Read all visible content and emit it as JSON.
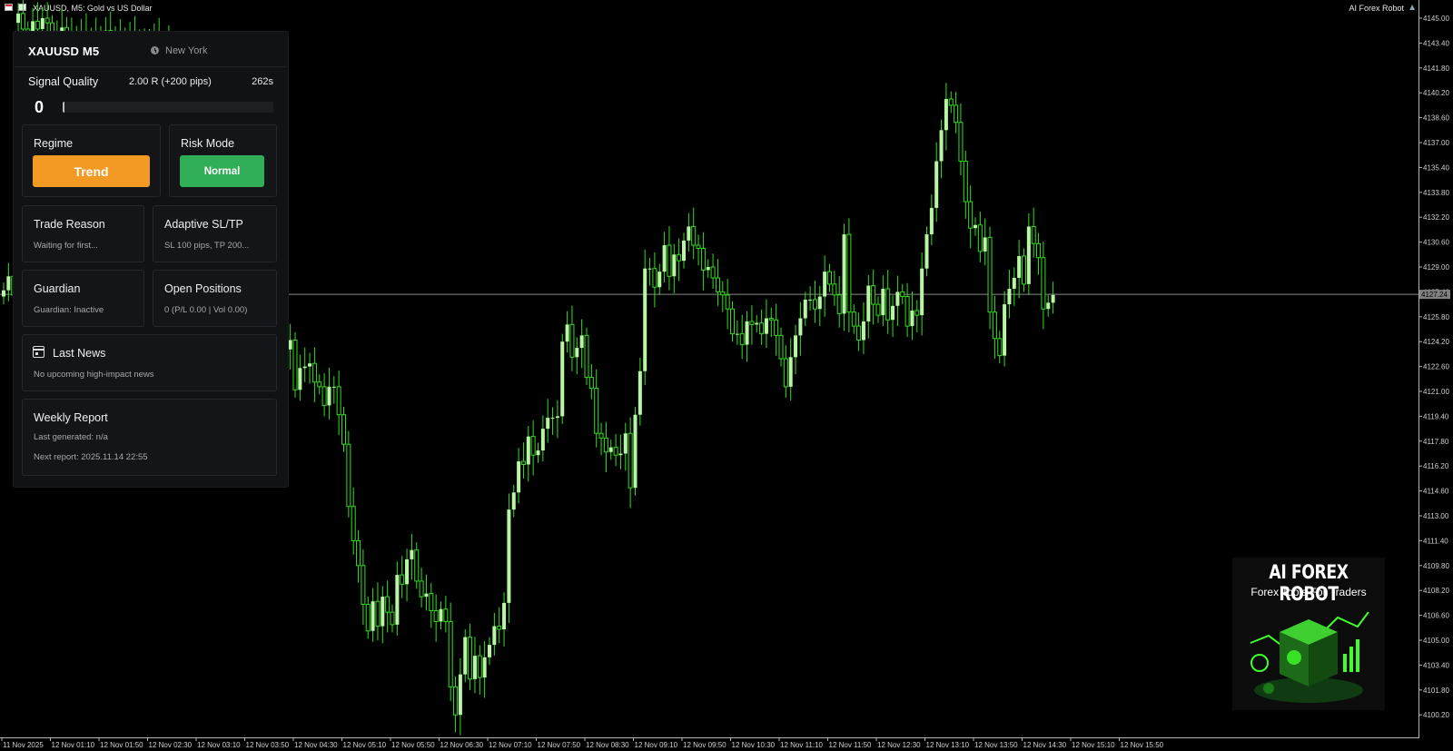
{
  "window": {
    "title": "XAUUSD, M5:  Gold vs US Dollar",
    "robot": "AI Forex Robot"
  },
  "panel": {
    "symbol": "XAUUSD M5",
    "city": "New York",
    "signal_quality": {
      "label": "Signal Quality",
      "value": "2.00 R (+200 pips)",
      "timer": "262s",
      "score": "0",
      "score_fraction": 0
    },
    "regime": {
      "title": "Regime",
      "value": "Trend",
      "color": "#f39a24"
    },
    "risk_mode": {
      "title": "Risk Mode",
      "value": "Normal",
      "color": "#2fae57"
    },
    "trade_reason": {
      "title": "Trade Reason",
      "text": "Waiting for first..."
    },
    "adaptive": {
      "title": "Adaptive SL/TP",
      "text": "SL 100 pips, TP 200..."
    },
    "guardian": {
      "title": "Guardian",
      "text": "Guardian: Inactive"
    },
    "positions": {
      "title": "Open Positions",
      "text": "0 (P/L 0.00 | Vol 0.00)"
    },
    "news": {
      "title": "Last News",
      "text": "No upcoming high-impact news"
    },
    "weekly": {
      "title": "Weekly Report",
      "last": "Last generated: n/a",
      "next": "Next report: 2025.11.14 22:55"
    }
  },
  "chart": {
    "type": "candlestick",
    "symbol": "XAUUSD",
    "timeframe": "M5",
    "bull_color": "#b9f6a4",
    "wick_color": "#2fe01a",
    "bid_line_color": "#8a8a8a",
    "current_price_label": "4127.24",
    "y_ticks": [
      "4145.00",
      "4143.40",
      "4141.80",
      "4140.20",
      "4138.60",
      "4137.00",
      "4135.40",
      "4133.80",
      "4132.20",
      "4130.60",
      "4129.00",
      "4127.40",
      "4125.80",
      "4124.20",
      "4122.60",
      "4121.00",
      "4119.40",
      "4117.80",
      "4116.20",
      "4114.60",
      "4113.00",
      "4111.40",
      "4109.80",
      "4108.20",
      "4106.60",
      "4105.00",
      "4103.40",
      "4101.80",
      "4100.20"
    ],
    "x_ticks": [
      "11 Nov 2025",
      "12 Nov 01:10",
      "12 Nov 01:50",
      "12 Nov 02:30",
      "12 Nov 03:10",
      "12 Nov 03:50",
      "12 Nov 04:30",
      "12 Nov 05:10",
      "12 Nov 05:50",
      "12 Nov 06:30",
      "12 Nov 07:10",
      "12 Nov 07:50",
      "12 Nov 08:30",
      "12 Nov 09:10",
      "12 Nov 09:50",
      "12 Nov 10:30",
      "12 Nov 11:10",
      "12 Nov 11:50",
      "12 Nov 12:30",
      "12 Nov 13:10",
      "12 Nov 13:50",
      "12 Nov 14:30",
      "12 Nov 15:10",
      "12 Nov 15:50"
    ],
    "closes": [
      4127.5,
      4128.4,
      4127.2,
      4145.3,
      4144.3,
      4143.9,
      4144.8,
      4144.3,
      4145.0,
      4144.7,
      4143.9,
      4144.0,
      4144.4,
      4143.8,
      4144.0,
      4143.5,
      4144.1,
      4143.7,
      4143.5,
      4144.0,
      4143.7,
      4144.2,
      4143.6,
      4143.8,
      4143.9,
      4143.3,
      4143.9,
      4143.6,
      4143.3,
      4143.3,
      4143.8,
      4143.8,
      4143.0,
      4143.5,
      4143.1,
      4143.0,
      4142.5,
      4142.6,
      4142.9,
      4142.4,
      4142.8,
      4142.6,
      4142.5,
      4142.2,
      4142.6,
      4142.1,
      4141.6,
      4141.6,
      4141.8,
      4141.4,
      4141.0,
      4140.8,
      4140.7,
      4131.3,
      4128.6,
      4126.6,
      4124.3,
      4121.3,
      4123.7,
      4124.3,
      4121.1,
      4122.5,
      4122.6,
      4122.8,
      4121.6,
      4121.3,
      4120.1,
      4121.3,
      4121.3,
      4119.5,
      4117.6,
      4113.6,
      4111.4,
      4109.8,
      4107.3,
      4105.6,
      4107.5,
      4105.9,
      4107.8,
      4106.8,
      4106.0,
      4109.2,
      4108.6,
      4110.2,
      4110.8,
      4108.8,
      4107.8,
      4108.0,
      4106.9,
      4106.2,
      4107.0,
      4106.2,
      4102.0,
      4100.2,
      4102.8,
      4105.2,
      4102.5,
      4104.0,
      4102.6,
      4103.9,
      4104.7,
      4105.9,
      4105.7,
      4107.4,
      4113.4,
      4114.5,
      4116.5,
      4116.3,
      4118.1,
      4116.9,
      4117.2,
      4118.6,
      4119.3,
      4119.3,
      4119.4,
      4124.2,
      4125.3,
      4123.2,
      4123.8,
      4124.6,
      4121.9,
      4121.2,
      4118.3,
      4118.0,
      4117.1,
      4117.4,
      4116.9,
      4117.0,
      4118.3,
      4114.8,
      4119.5,
      4122.3,
      4128.9,
      4128.9,
      4127.7,
      4128.7,
      4130.4,
      4128.4,
      4129.8,
      4129.4,
      4130.7,
      4131.6,
      4130.4,
      4130.2,
      4128.8,
      4129.0,
      4128.3,
      4127.4,
      4127.2,
      4126.3,
      4124.7,
      4124.7,
      4124.0,
      4125.5,
      4125.3,
      4125.4,
      4124.7,
      4125.7,
      4125.6,
      4124.6,
      4123.1,
      4121.3,
      4123.2,
      4124.6,
      4125.7,
      4126.9,
      4126.9,
      4126.3,
      4127.1,
      4128.7,
      4127.9,
      4127.2,
      4126.0,
      4131.1,
      4126.1,
      4125.2,
      4124.3,
      4125.5,
      4127.8,
      4126.6,
      4125.9,
      4127.6,
      4125.6,
      4126.5,
      4127.4,
      4127.1,
      4125.2,
      4126.2,
      4125.9,
      4128.9,
      4131.1,
      4132.8,
      4135.8,
      4137.8,
      4139.8,
      4139.4,
      4138.3,
      4135.8,
      4133.2,
      4131.5,
      4131.7,
      4130.0,
      4130.9,
      4126.1,
      4124.4,
      4123.3,
      4126.6,
      4127.6,
      4128.3,
      4129.7,
      4127.9,
      4131.6,
      4130.5,
      4129.6,
      4126.3,
      4126.7,
      4127.2
    ]
  },
  "branding": {
    "title": "AI FOREX ROBOT",
    "subtitle": "Forex Tools For Traders"
  }
}
